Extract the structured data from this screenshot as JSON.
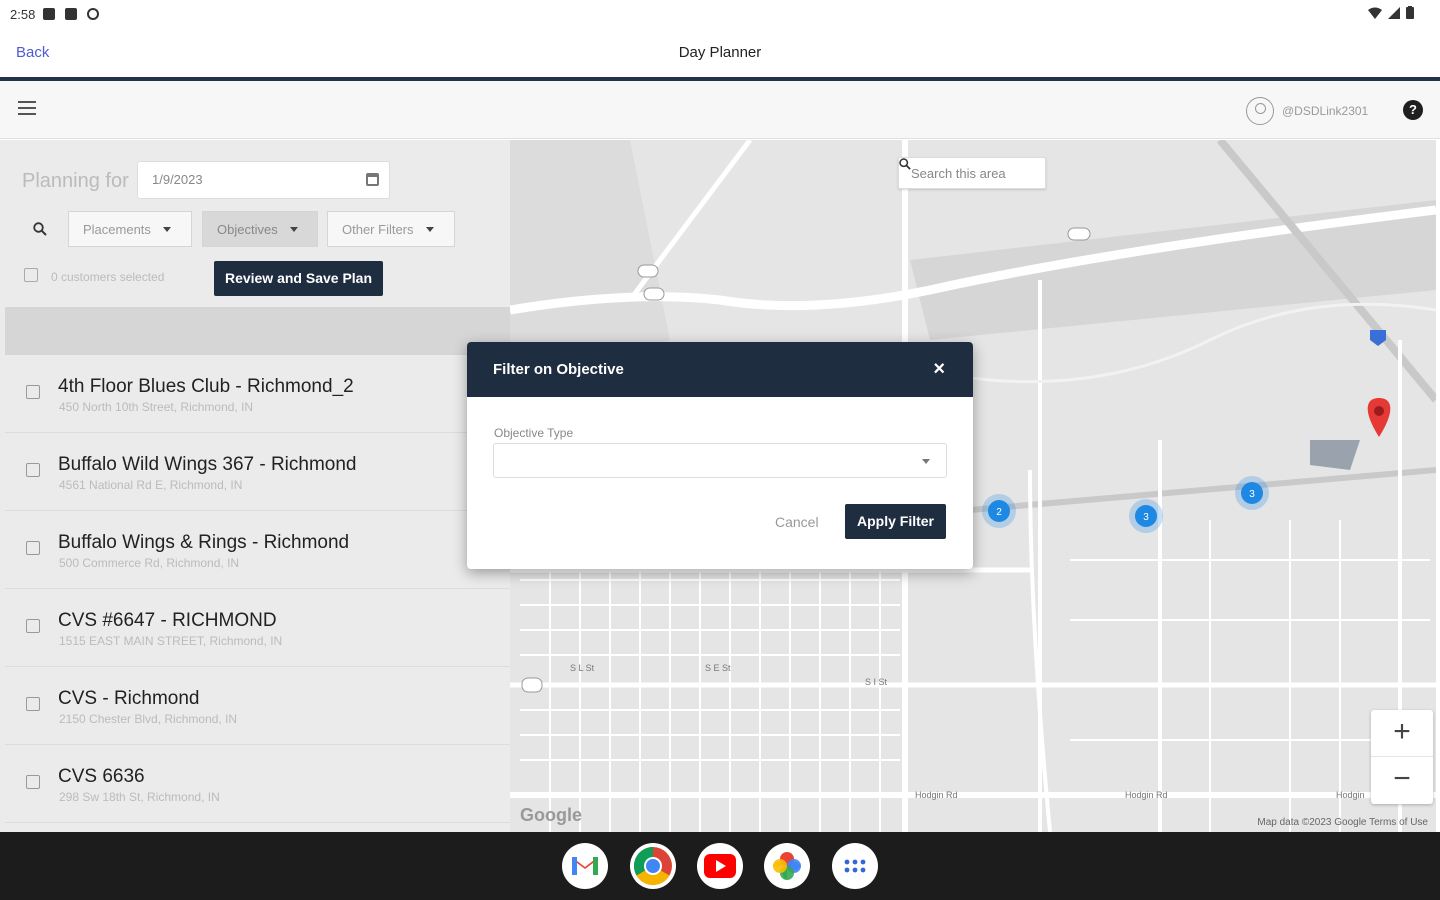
{
  "status_bar": {
    "time": "2:58"
  },
  "header": {
    "back_label": "Back",
    "title": "Day Planner"
  },
  "toolbar": {
    "username": "@DSDLink2301",
    "help_label": "?"
  },
  "planner": {
    "planning_label": "Planning for",
    "date": "1/9/2023",
    "filters": [
      "Placements",
      "Objectives",
      "Other Filters"
    ],
    "customers_selected": "0 customers selected",
    "review_button": "Review and Save Plan"
  },
  "customers": [
    {
      "name": "4th Floor Blues Club - Richmond_2",
      "address": "450 North 10th Street, Richmond, IN"
    },
    {
      "name": "Buffalo Wild Wings 367 - Richmond",
      "address": "4561 National Rd E, Richmond, IN"
    },
    {
      "name": "Buffalo Wings & Rings - Richmond",
      "address": "500 Commerce Rd, Richmond, IN"
    },
    {
      "name": "CVS #6647 - RICHMOND",
      "address": "1515 EAST MAIN STREET, Richmond, IN"
    },
    {
      "name": "CVS - Richmond",
      "address": "2150 Chester Blvd, Richmond, IN"
    },
    {
      "name": "CVS 6636",
      "address": "298 Sw 18th St, Richmond, IN"
    }
  ],
  "map": {
    "search_label": "Search this area",
    "zoom_in": "+",
    "zoom_out": "−",
    "google_logo": "Google",
    "credit": "Map data ©2023 Google   Terms of Use",
    "cluster_labels": [
      "2",
      "3",
      "3"
    ],
    "road_labels": [
      "S L St",
      "S E St",
      "S I St",
      "Hodgin Rd",
      "Hodgin Rd",
      "Hodgin"
    ],
    "marker_color": "#e53935",
    "cluster_color": "#1e88e5"
  },
  "modal": {
    "title": "Filter on Objective",
    "close_label": "×",
    "field_label": "Objective Type",
    "cancel_label": "Cancel",
    "apply_label": "Apply Filter"
  },
  "dock_apps": [
    "gmail-icon",
    "chrome-icon",
    "youtube-icon",
    "photos-icon",
    "app-drawer-icon"
  ]
}
